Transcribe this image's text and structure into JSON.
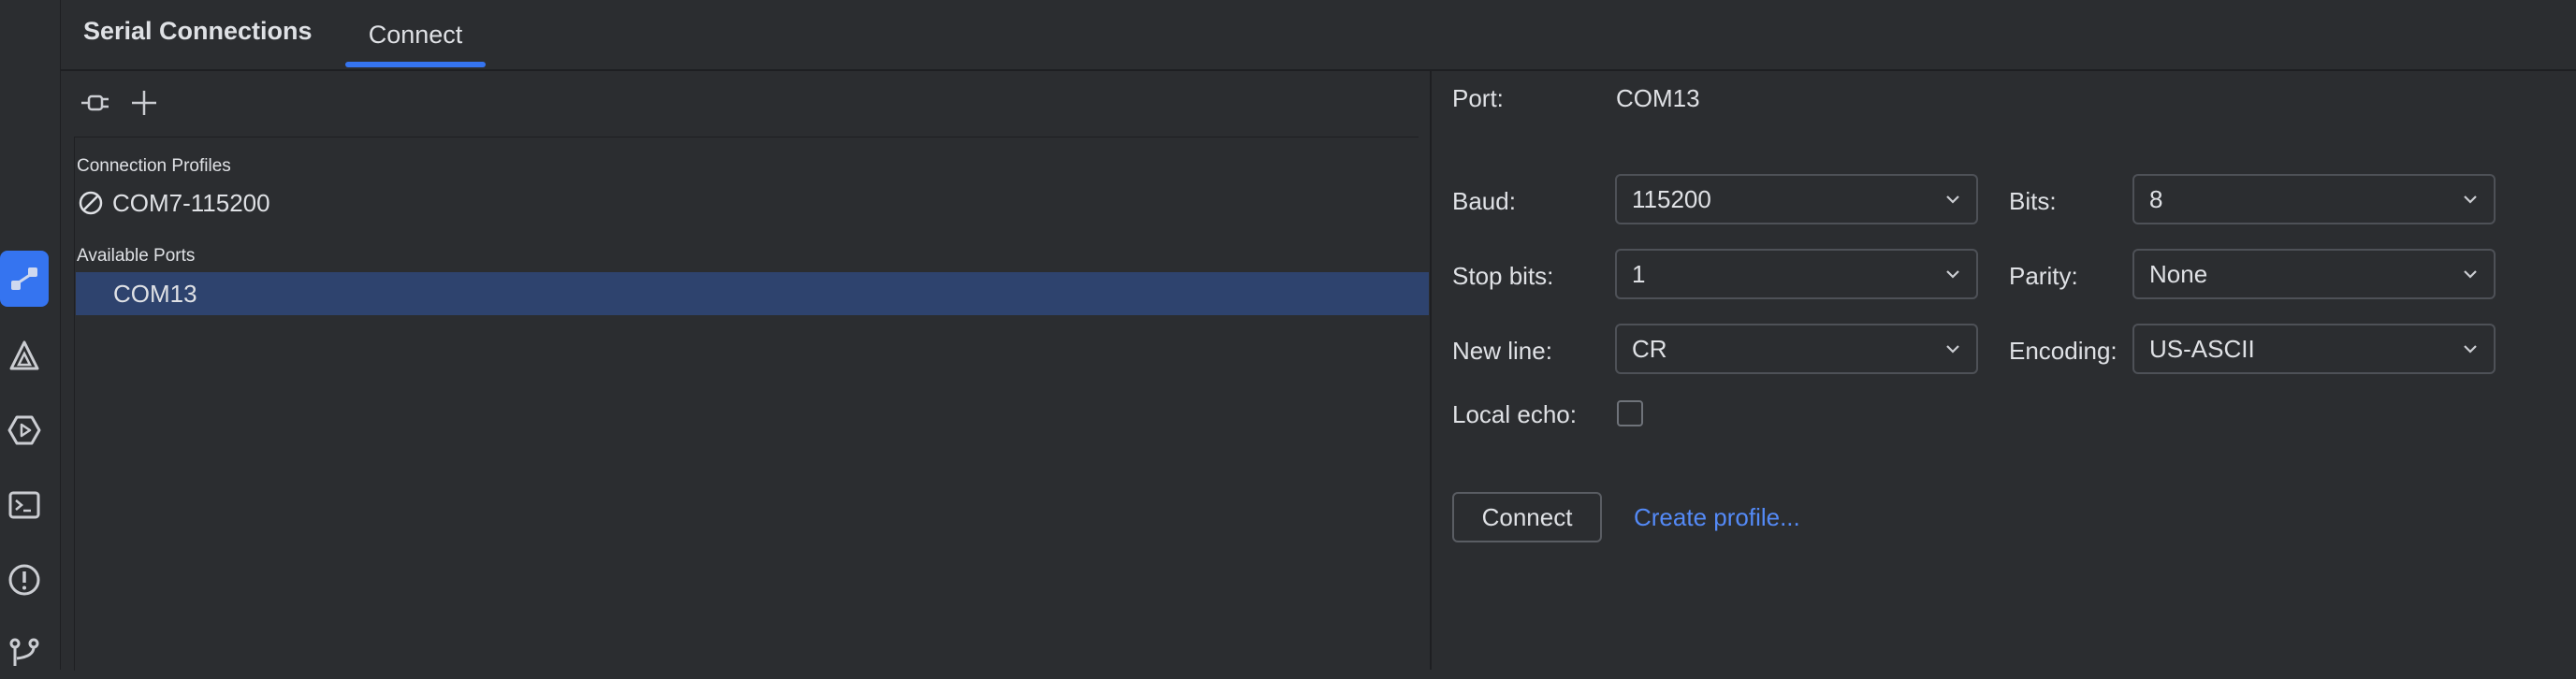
{
  "tabs": {
    "title": "Serial Connections",
    "connect_tab": "Connect"
  },
  "left_strip": {
    "icons": [
      "connections-icon",
      "build-icon",
      "run-icon",
      "terminal-icon",
      "problems-icon",
      "git-icon"
    ]
  },
  "toolbar": {
    "icons": [
      "plug-icon",
      "add-icon"
    ]
  },
  "tree": {
    "profiles_header": "Connection Profiles",
    "profile_item": "COM7-115200",
    "ports_header": "Available Ports",
    "port_item": "COM13"
  },
  "form": {
    "port_label": "Port:",
    "port_value": "COM13",
    "baud_label": "Baud:",
    "baud_value": "115200",
    "bits_label": "Bits:",
    "bits_value": "8",
    "stopbits_label": "Stop bits:",
    "stopbits_value": "1",
    "parity_label": "Parity:",
    "parity_value": "None",
    "newline_label": "New line:",
    "newline_value": "CR",
    "encoding_label": "Encoding:",
    "encoding_value": "US-ASCII",
    "localecho_label": "Local echo:",
    "connect_button": "Connect",
    "create_profile_link": "Create profile..."
  },
  "colors": {
    "accent": "#3574f0",
    "selection": "#2e436e",
    "link": "#548af7",
    "background": "#2b2d30"
  }
}
